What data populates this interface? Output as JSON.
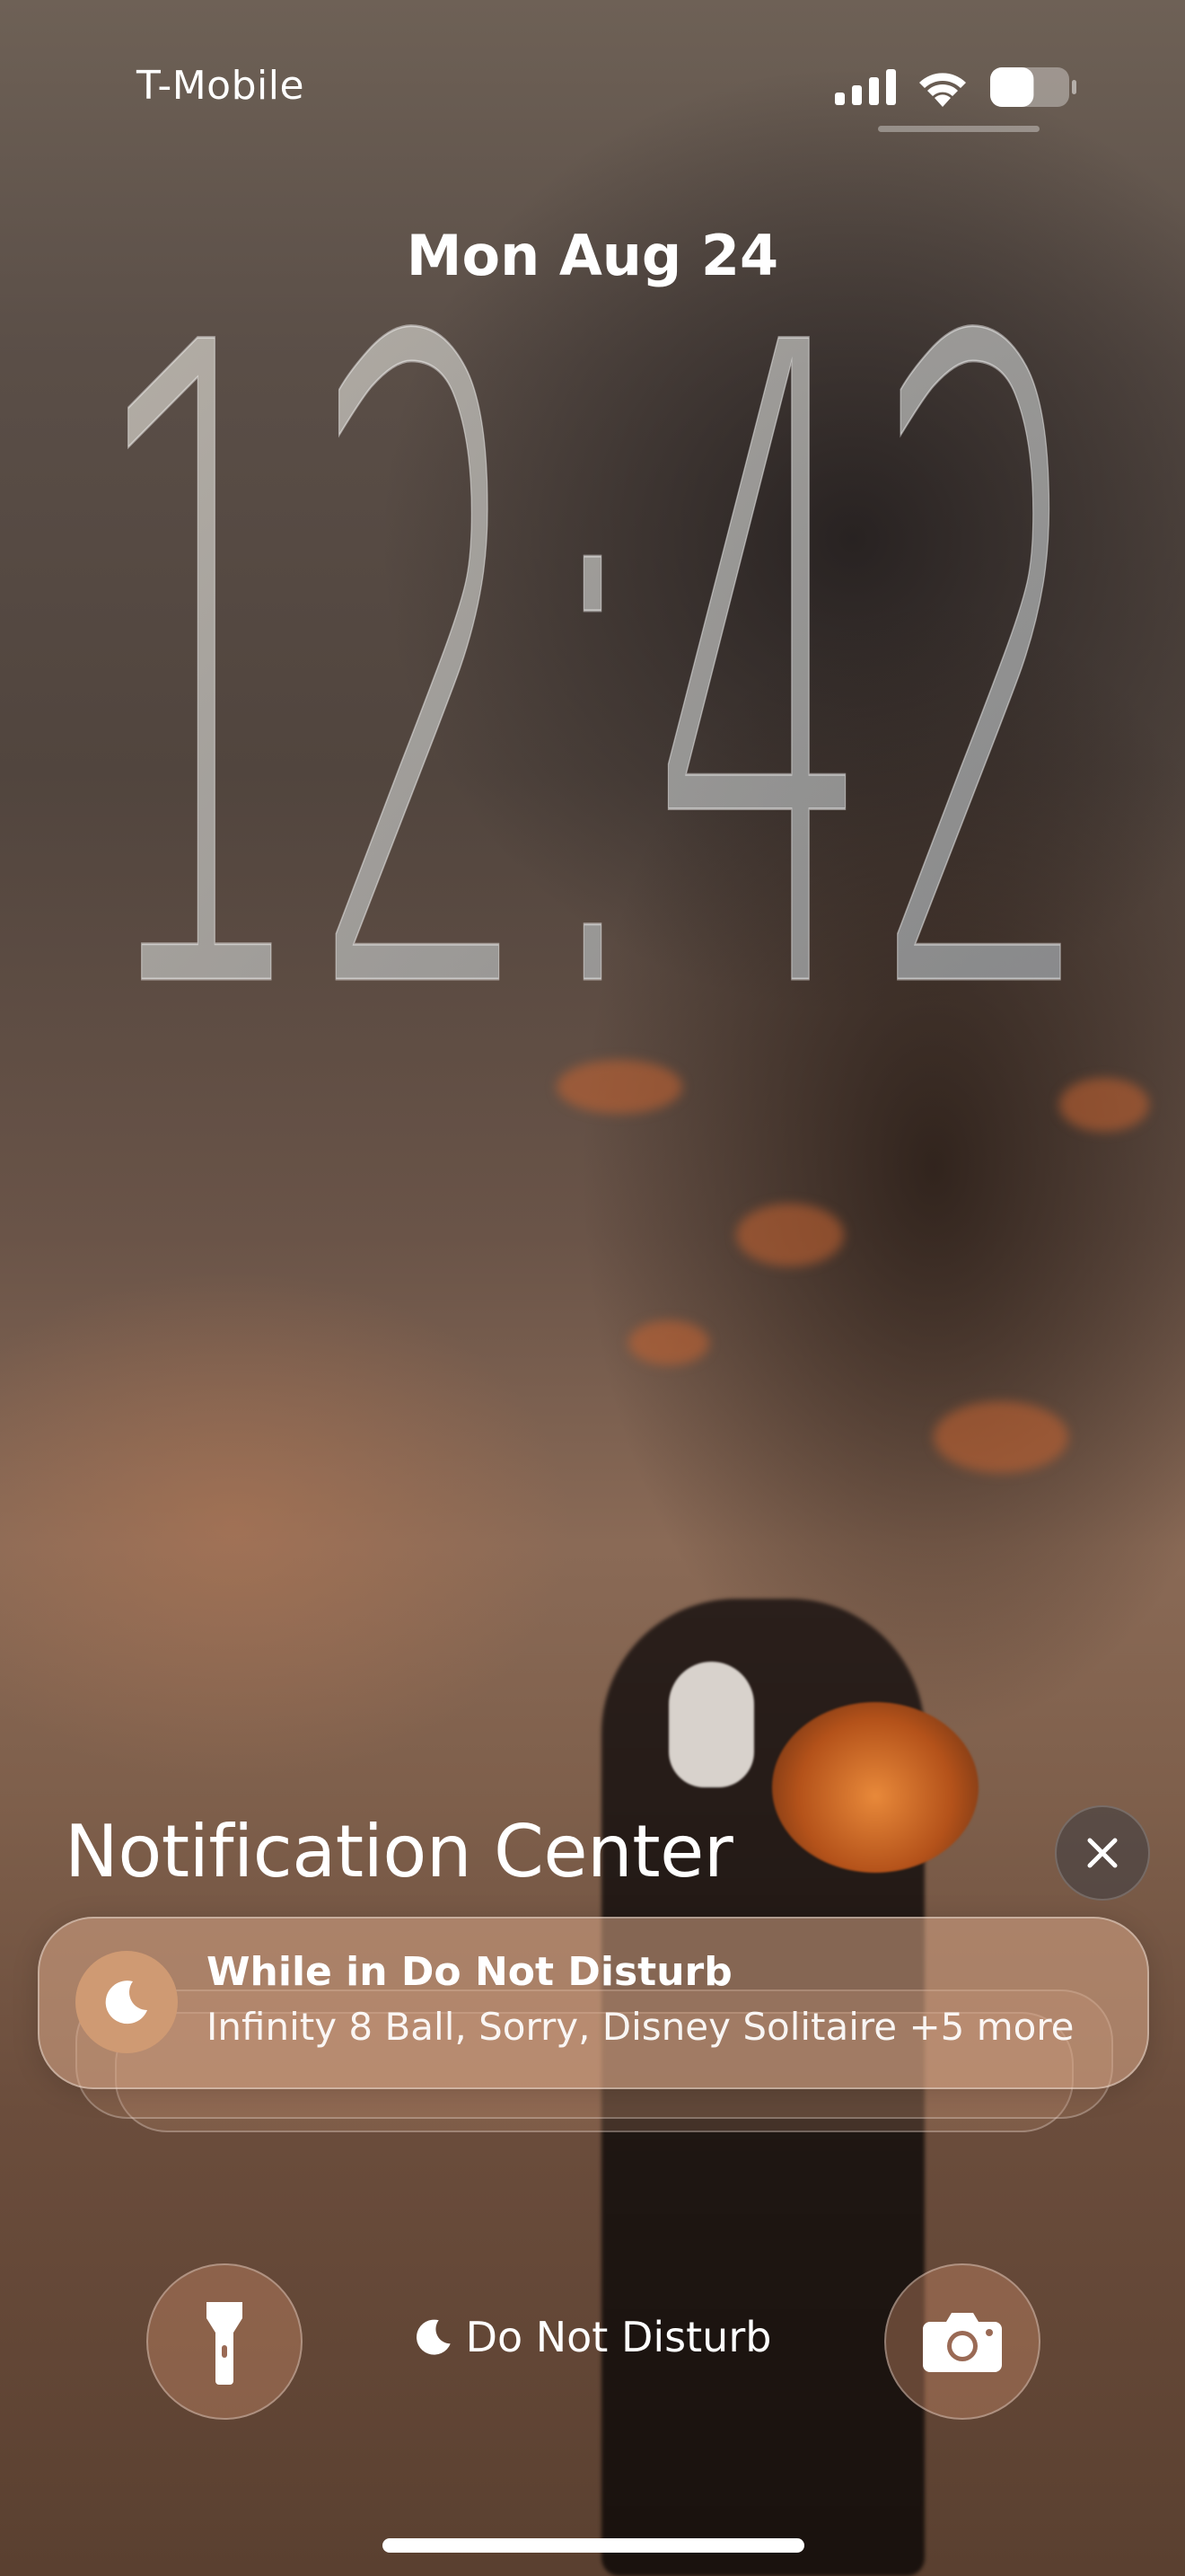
{
  "status_bar": {
    "carrier": "T-Mobile",
    "signal_icon": "cellular-signal-icon",
    "wifi_icon": "wifi-icon",
    "battery_icon": "battery-icon",
    "battery_level": 0.55
  },
  "lock_screen": {
    "date": "Mon Aug 24",
    "time": "12:42"
  },
  "notification_center": {
    "title": "Notification Center",
    "close_icon": "close-icon",
    "notification": {
      "icon": "moon-icon",
      "title": "While in Do Not Disturb",
      "body": "Infinity 8 Ball, Sorry, Disney Solitaire +5 more"
    }
  },
  "bottom": {
    "flashlight_icon": "flashlight-icon",
    "camera_icon": "camera-icon",
    "focus_icon": "moon-icon",
    "focus_label": "Do Not Disturb"
  }
}
